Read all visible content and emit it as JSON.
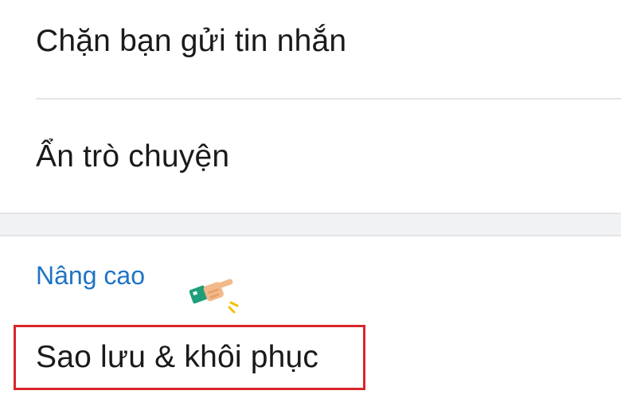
{
  "menu": {
    "items": [
      {
        "label": "Chặn bạn gửi tin nhắn"
      },
      {
        "label": "Ẩn trò chuyện"
      }
    ],
    "advanced_section": {
      "header": "Nâng cao",
      "items": [
        {
          "label": "Sao lưu & khôi phục"
        }
      ]
    }
  },
  "annotations": {
    "pointer_icon": "pointing-hand-icon",
    "highlight_color": "#d8252a"
  },
  "colors": {
    "section_header": "#1f73c4",
    "divider": "#e3e5e8",
    "section_gap_bg": "#f1f2f4"
  }
}
